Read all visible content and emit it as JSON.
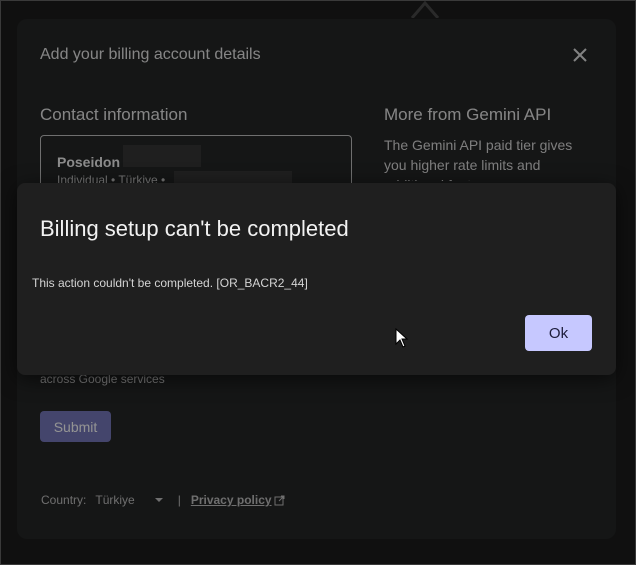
{
  "billing_dialog": {
    "title": "Add your billing account details",
    "close_icon": "close-icon",
    "contact": {
      "heading": "Contact information",
      "name": "Poseidon",
      "subtitle": "Individual • Türkiye •"
    },
    "more": {
      "heading": "More from Gemini API",
      "text": "The Gemini API paid tier gives you higher rate limits and additional features"
    },
    "services_text": "across Google services",
    "submit_label": "Submit",
    "footer": {
      "country_label": "Country:",
      "country_value": "Türkiye",
      "separator": "|",
      "privacy_label": "Privacy policy"
    }
  },
  "error_dialog": {
    "title": "Billing setup can't be completed",
    "message": "This action couldn't be completed. [OR_BACR2_44]",
    "ok_label": "Ok"
  },
  "colors": {
    "ok_button": "#c6c8ff",
    "submit_button": "#6f72b8",
    "dialog_bg": "#1f1f1f"
  }
}
